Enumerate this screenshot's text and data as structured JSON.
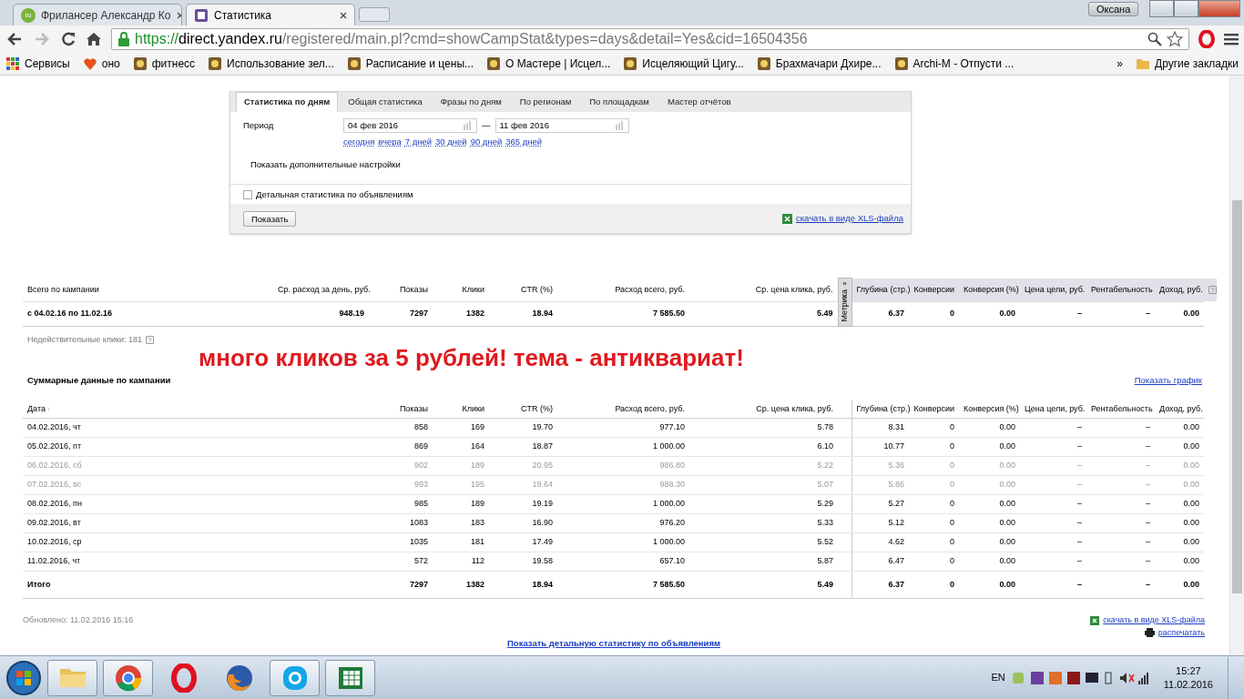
{
  "browser": {
    "tabs": [
      {
        "title": "Фрилансер Александр Ко",
        "favicon": "ru",
        "selected": false
      },
      {
        "title": "Статистика",
        "selected": true
      }
    ],
    "user": "Оксана",
    "url": {
      "scheme": "https://",
      "host": "direct.yandex.ru",
      "path": "/registered/main.pl?cmd=showCampStat&types=days&detail=Yes&cid=16504356"
    },
    "bookmarks": [
      {
        "label": "Сервисы",
        "kind": "apps"
      },
      {
        "label": "оно",
        "kind": "heart"
      },
      {
        "label": "фитнесс",
        "kind": "page"
      },
      {
        "label": "Использование зел...",
        "kind": "page"
      },
      {
        "label": "Расписание и цены...",
        "kind": "page"
      },
      {
        "label": "О Мастере | Исцел...",
        "kind": "page"
      },
      {
        "label": "Исцеляющий Цигу...",
        "kind": "page"
      },
      {
        "label": "Брахмачари Дхире...",
        "kind": "page"
      },
      {
        "label": "Archi-M - Отпусти ...",
        "kind": "page"
      }
    ],
    "more": "»",
    "other_bookmarks": "Другие закладки"
  },
  "filter": {
    "tabs": [
      {
        "label": "Статистика по дням",
        "selected": true
      },
      {
        "label": "Общая статистика",
        "selected": false
      },
      {
        "label": "Фразы по дням",
        "selected": false
      },
      {
        "label": "По регионам",
        "selected": false
      },
      {
        "label": "По площадкам",
        "selected": false
      },
      {
        "label": "Мастер отчётов",
        "selected": false
      }
    ],
    "period_label": "Период",
    "date_from": "04 фев 2016",
    "date_sep": "—",
    "date_to": "11 фев 2016",
    "quick_links": [
      "сегодня",
      "вчера",
      "7 дней",
      "30 дней",
      "90 дней",
      "365 дней"
    ],
    "more_settings": "Показать дополнительные настройки",
    "detail_checkbox": {
      "label": "Детальная статистика по объявлениям",
      "checked": false
    },
    "submit": "Показать",
    "xls_link": "скачать в виде XLS-файла"
  },
  "summary": {
    "columns": [
      "Всего по кампании",
      "Ср. расход за день, руб.",
      "Показы",
      "Клики",
      "CTR (%)",
      "Расход всего, руб.",
      "Ср. цена клика, руб.",
      "Глубина (стр.)",
      "Конверсии",
      "Конверсия (%)",
      "Цена цели, руб.",
      "Рентабельность",
      "Доход, руб."
    ],
    "metrika": {
      "label": "Метрика",
      "toggle": "»"
    },
    "row": [
      "с 04.02.16 по 11.02.16",
      "948.19",
      "7297",
      "1382",
      "18.94",
      "7 585.50",
      "5.49",
      "6.37",
      "0",
      "0.00",
      "–",
      "–",
      "0.00"
    ],
    "help": "?"
  },
  "invalid_clicks": {
    "text": "Недействительные клики: 181",
    "help": "?"
  },
  "annotation": "много кликов за 5 рублей! тема - антиквариат!",
  "daily": {
    "title": "Суммарные данные по кампании",
    "chart_link": "Показать график",
    "columns": [
      "Дата",
      "Показы",
      "Клики",
      "CTR (%)",
      "Расход всего, руб.",
      "Ср. цена клика, руб.",
      "Глубина (стр.)",
      "Конверсии",
      "Конверсия (%)",
      "Цена цели, руб.",
      "Рентабельность",
      "Доход, руб."
    ],
    "sort_mark": "↑",
    "rows": [
      {
        "cells": [
          "04.02.2016, чт",
          "858",
          "169",
          "19.70",
          "977.10",
          "5.78",
          "8.31",
          "0",
          "0.00",
          "–",
          "–",
          "0.00"
        ],
        "muted": false
      },
      {
        "cells": [
          "05.02.2016, пт",
          "869",
          "164",
          "18.87",
          "1 000.00",
          "6.10",
          "10.77",
          "0",
          "0.00",
          "–",
          "–",
          "0.00"
        ],
        "muted": false
      },
      {
        "cells": [
          "06.02.2016, сб",
          "902",
          "189",
          "20.95",
          "986.80",
          "5.22",
          "5.36",
          "0",
          "0.00",
          "–",
          "–",
          "0.00"
        ],
        "muted": true
      },
      {
        "cells": [
          "07.02.2016, вс",
          "993",
          "195",
          "19.64",
          "988.30",
          "5.07",
          "5.86",
          "0",
          "0.00",
          "–",
          "–",
          "0.00"
        ],
        "muted": true
      },
      {
        "cells": [
          "08.02.2016, пн",
          "985",
          "189",
          "19.19",
          "1 000.00",
          "5.29",
          "5.27",
          "0",
          "0.00",
          "–",
          "–",
          "0.00"
        ],
        "muted": false
      },
      {
        "cells": [
          "09.02.2016, вт",
          "1083",
          "183",
          "16.90",
          "976.20",
          "5.33",
          "5.12",
          "0",
          "0.00",
          "–",
          "–",
          "0.00"
        ],
        "muted": false
      },
      {
        "cells": [
          "10.02.2016, ср",
          "1035",
          "181",
          "17.49",
          "1 000.00",
          "5.52",
          "4.62",
          "0",
          "0.00",
          "–",
          "–",
          "0.00"
        ],
        "muted": false
      },
      {
        "cells": [
          "11.02.2016, чт",
          "572",
          "112",
          "19.58",
          "657.10",
          "5.87",
          "6.47",
          "0",
          "0.00",
          "–",
          "–",
          "0.00"
        ],
        "muted": false
      }
    ],
    "total": [
      "Итого",
      "7297",
      "1382",
      "18.94",
      "7 585.50",
      "5.49",
      "6.37",
      "0",
      "0.00",
      "–",
      "–",
      "0.00"
    ]
  },
  "footer": {
    "updated": "Обновлено: 11.02.2016 15:16",
    "xls_link": "скачать в виде XLS-файла",
    "print_link": "распечатать",
    "detail_link": "Показать детальную статистику по объявлениям"
  },
  "taskbar": {
    "apps": [
      {
        "kind": "folder",
        "running": true
      },
      {
        "kind": "chrome",
        "running": true
      },
      {
        "kind": "opera",
        "running": false
      },
      {
        "kind": "firefox",
        "running": false
      },
      {
        "kind": "skype",
        "running": true
      },
      {
        "kind": "excel",
        "running": true
      }
    ],
    "language": "EN",
    "time": "15:27",
    "date": "11.02.2016"
  }
}
